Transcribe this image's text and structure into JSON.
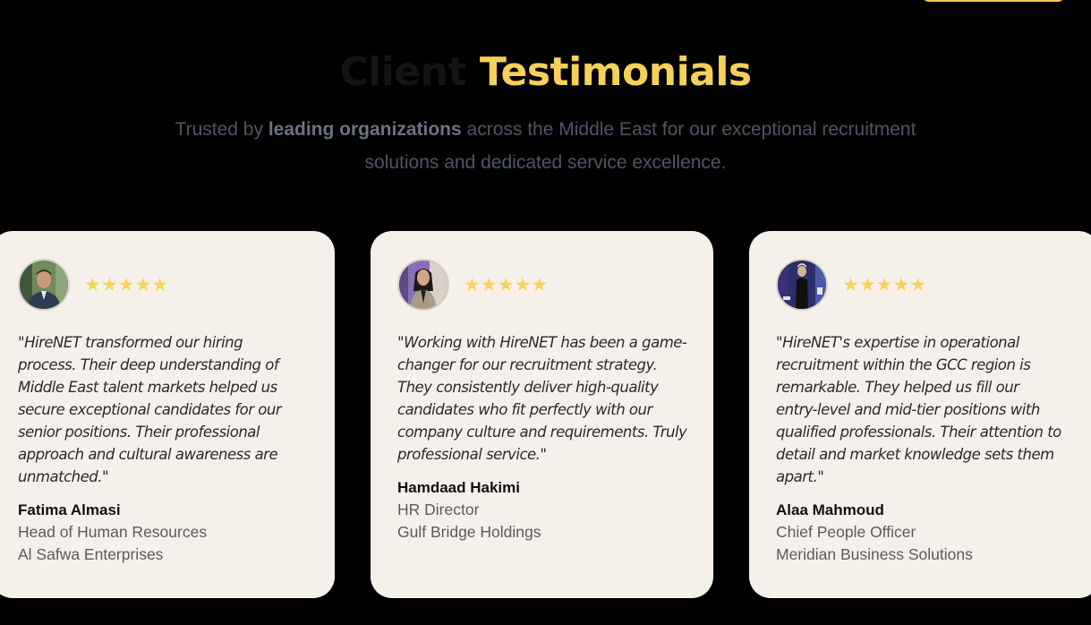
{
  "heading": {
    "muted": "Client",
    "accent": "Testimonials"
  },
  "subtitle": {
    "before": "Trusted by ",
    "strong": "leading organizations",
    "after": " across the Middle East for our exceptional recruitment solutions and dedicated service excellence."
  },
  "rating_stars": "★★★★★",
  "testimonials": [
    {
      "quote": "\"HireNET transformed our hiring process. Their deep understanding of Middle East talent markets helped us secure exceptional candidates for our senior positions. Their professional approach and cultural awareness are unmatched.\"",
      "name": "Fatima Almasi",
      "role": "Head of Human Resources",
      "company": "Al Safwa Enterprises",
      "rating": 5
    },
    {
      "quote": "\"Working with HireNET has been a game-changer for our recruitment strategy. They consistently deliver high-quality candidates who fit perfectly with our company culture and requirements. Truly professional service.\"",
      "name": "Hamdaad Hakimi",
      "role": "HR Director",
      "company": "Gulf Bridge Holdings",
      "rating": 5
    },
    {
      "quote": "\"HireNET's expertise in operational recruitment within the GCC region is remarkable. They helped us fill our entry-level and mid-tier positions with qualified professionals. Their attention to detail and market knowledge sets them apart.\"",
      "name": "Alaa Mahmoud",
      "role": "Chief People Officer",
      "company": "Meridian Business Solutions",
      "rating": 5
    }
  ],
  "colors": {
    "accent": "#f5d15a",
    "card_bg": "#f5f1ea",
    "page_bg": "#000000",
    "star": "#f7d35b"
  }
}
